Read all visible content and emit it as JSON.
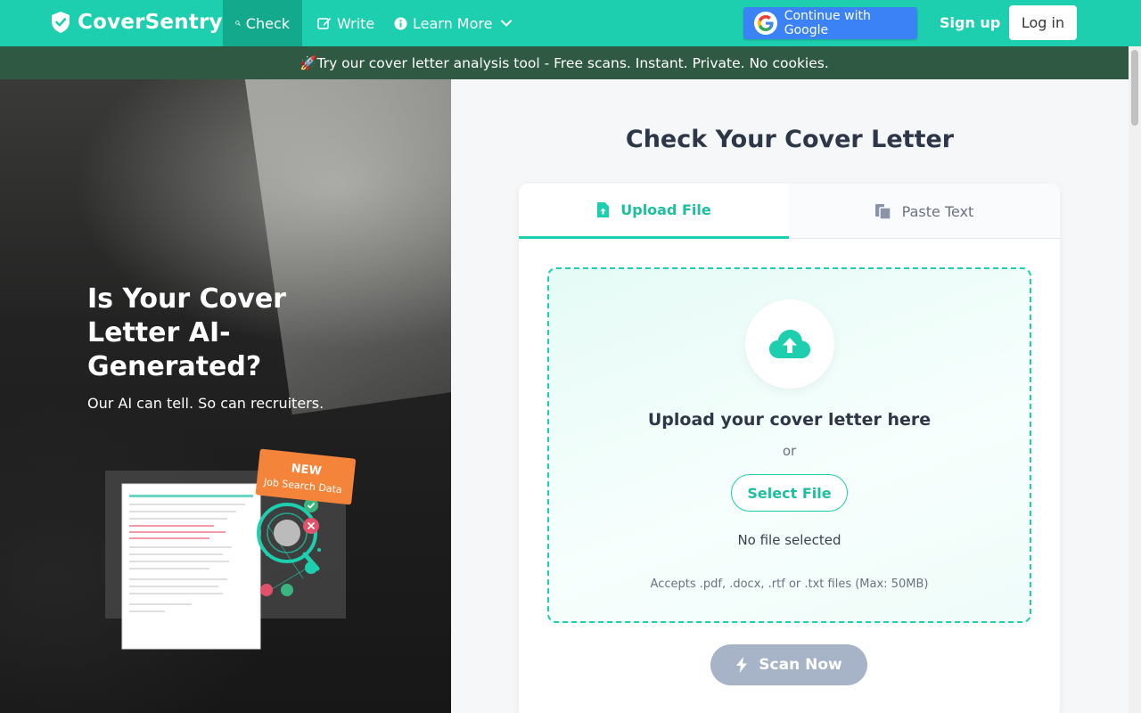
{
  "navbar": {
    "brand": "CoverSentry",
    "items": [
      {
        "label": "Check",
        "icon": "search-icon",
        "active": true
      },
      {
        "label": "Write",
        "icon": "edit-icon"
      },
      {
        "label": "Learn More",
        "icon": "info-icon"
      }
    ],
    "google_label": "Continue with Google",
    "signup_label": "Sign up",
    "login_label": "Log in",
    "colors": {
      "primary": "#1dcfae",
      "active": "#13a98d",
      "google": "#3b82f6"
    }
  },
  "banner": {
    "text": "🚀Try our cover letter analysis tool - Free scans. Instant. Private. No cookies."
  },
  "hero": {
    "title": "Is Your Cover Letter AI-Generated?",
    "subtitle": "Our AI can tell. So can recruiters.",
    "badge_new": "NEW",
    "badge_sub": "Job Search Data"
  },
  "checker": {
    "title": "Check Your Cover Letter",
    "tabs": [
      {
        "label": "Upload File",
        "icon": "file-upload-icon",
        "active": true
      },
      {
        "label": "Paste Text",
        "icon": "clipboard-icon",
        "active": false
      }
    ],
    "dropzone_title": "Upload your cover letter here",
    "or_text": "or",
    "select_label": "Select File",
    "file_status": "No file selected",
    "accepts": "Accepts .pdf, .docx, .rtf or .txt files (Max: 50MB)",
    "scan_label": "Scan Now"
  }
}
